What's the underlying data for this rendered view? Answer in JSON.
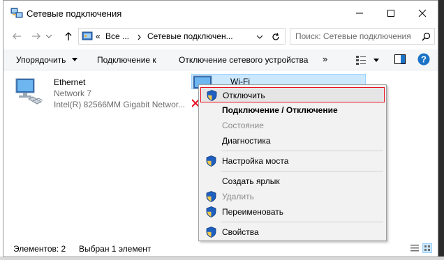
{
  "window": {
    "title": "Сетевые подключения"
  },
  "address": {
    "prefix": "«",
    "crumb1": "Все ...",
    "crumb2": "Сетевые подключен...",
    "search_placeholder": "Поиск: Сетевые подключения"
  },
  "commands": {
    "organize": "Упорядочить",
    "connect": "Подключение к",
    "disconnect": "Отключение сетевого устройства",
    "more": "»"
  },
  "items": [
    {
      "name": "Ethernet",
      "network": "Network  7",
      "adapter": "Intel(R) 82566MM Gigabit Networ..."
    },
    {
      "name": "Wi-Fi"
    }
  ],
  "status": {
    "count": "Элементов: 2",
    "selected": "Выбран 1 элемент"
  },
  "context_menu": {
    "items": [
      {
        "label": "Отключить",
        "shield": true,
        "state": "highlighted"
      },
      {
        "label": "Подключение / Отключение",
        "shield": false,
        "state": "bold"
      },
      {
        "label": "Состояние",
        "shield": false,
        "state": "disabled"
      },
      {
        "label": "Диагностика",
        "shield": false,
        "state": "normal"
      },
      {
        "label": "Настройка моста",
        "shield": true,
        "state": "normal"
      },
      {
        "label": "Создать ярлык",
        "shield": false,
        "state": "normal"
      },
      {
        "label": "Удалить",
        "shield": true,
        "state": "disabled"
      },
      {
        "label": "Переименовать",
        "shield": true,
        "state": "normal"
      },
      {
        "label": "Свойства",
        "shield": true,
        "state": "normal"
      }
    ]
  },
  "colors": {
    "accent": "#1a73c6",
    "highlight_border": "#e81123",
    "selection": "#cce8ff"
  }
}
